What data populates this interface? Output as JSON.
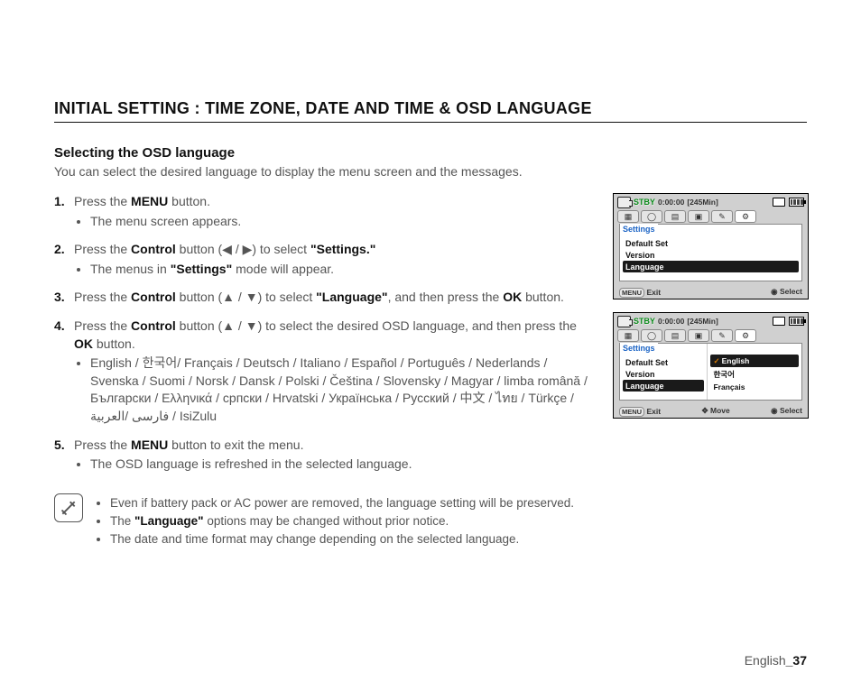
{
  "heading": "INITIAL SETTING : TIME ZONE, DATE AND TIME & OSD LANGUAGE",
  "sub": "Selecting the OSD language",
  "intro": "You can select the desired language to display the menu screen and the messages.",
  "steps": {
    "s1": {
      "text_a": "Press the ",
      "b": "MENU",
      "text_b": " button.",
      "bul": "The menu screen appears."
    },
    "s2": {
      "text_a": " Press the ",
      "b": "Control",
      "text_b": " button (",
      "arrows": "◀ / ▶",
      "text_c": ") to select ",
      "q": "\"Settings.\"",
      "bul_a": "The menus in ",
      "bul_q": "\"Settings\"",
      "bul_b": " mode will appear."
    },
    "s3": {
      "text_a": "Press the ",
      "b": "Control",
      "text_b": " button (",
      "arrows": "▲ / ▼",
      "text_c": ") to select ",
      "q": "\"Language\"",
      "text_d": ", and then press the ",
      "b2": "OK",
      "text_e": " button."
    },
    "s4": {
      "text_a": "Press the ",
      "b": "Control",
      "text_b": " button (",
      "arrows": "▲ / ▼",
      "text_c": ") to select the desired OSD language, and then press the ",
      "b2": "OK",
      "text_d": " button.",
      "langs": "English / 한국어/ Français / Deutsch / Italiano / Español / Português / Nederlands / Svenska / Suomi / Norsk / Dansk / Polski / Čeština / Slovensky / Magyar / limba română / Български / Ελληνικά / српски / Hrvatski / Українська / Русский /  中文  / ไทย / Türkçe / فارسی /العربية / IsiZulu"
    },
    "s5": {
      "text_a": "Press the ",
      "b": "MENU",
      "text_b": " button to exit the menu.",
      "bul": "The OSD language is refreshed in the selected language."
    }
  },
  "notes": {
    "n1": "Even if battery pack or AC power are removed, the language setting will be preserved.",
    "n2_a": "The ",
    "n2_q": "\"Language\"",
    "n2_b": " options may be changed without prior notice.",
    "n3": "The date and time format may change depending on the selected language."
  },
  "screen": {
    "stby": "STBY",
    "time": "0:00:00",
    "remain": "[245Min]",
    "settings": "Settings",
    "default": "Default Set",
    "version": "Version",
    "language": "Language",
    "menu": "MENU",
    "exit": "Exit",
    "select": "Select",
    "move": "Move",
    "english": "English",
    "korean": "한국어",
    "french": "Français"
  },
  "footer": {
    "label": "English",
    "page": "_37"
  }
}
